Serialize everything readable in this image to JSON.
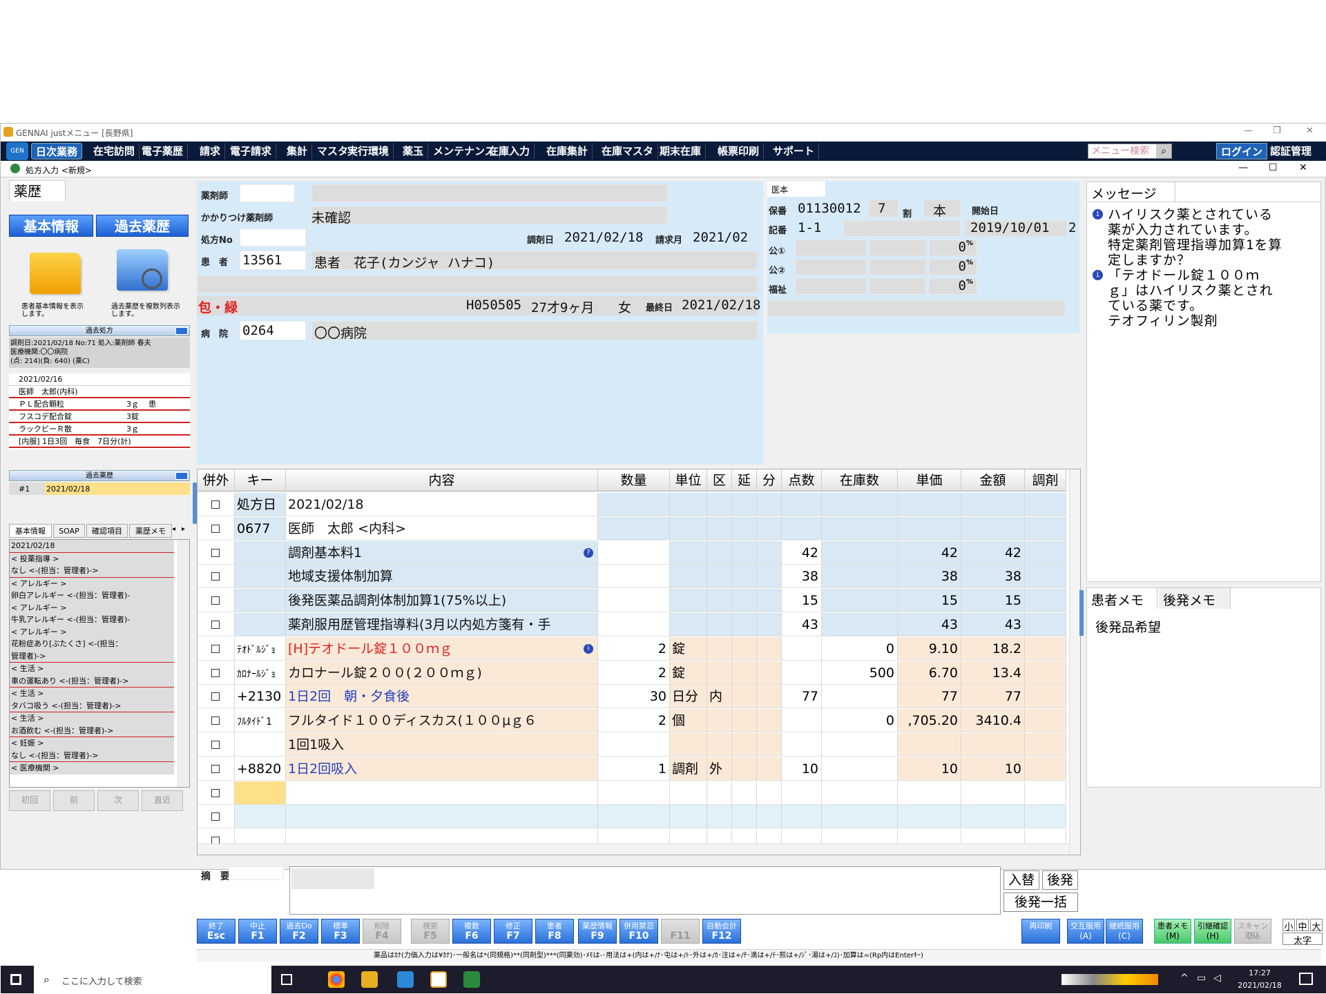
{
  "window": {
    "title": "GENNAI justメニュー [長野県]",
    "sub_title": "処方入力 <新規>"
  },
  "menu": {
    "logo": "GEN",
    "items": [
      "日次業務",
      "在宅訪問",
      "電子薬歴",
      "請求",
      "電子請求",
      "集計",
      "マスタ",
      "実行環境",
      "薬玉",
      "メンテナンス",
      "在庫入力",
      "在庫集計",
      "在庫マスタ",
      "期末在庫",
      "帳票印刷",
      "サポート"
    ],
    "search_placeholder": "メニュー検索",
    "login": "ログイン",
    "auth": "認証管理"
  },
  "left": {
    "tab": "薬歴",
    "btn_basic": "基本情報",
    "btn_past": "過去薬歴",
    "basic_caption": "患者基本情報を表示します。",
    "past_caption": "過去薬歴を複数列表示します。",
    "past_rx_header": "過去処方",
    "past_rx_info": [
      "調剤日:2021/02/18 No:71 処入:薬剤師 春夫",
      "医療機関:〇〇病院",
      "(点: 214)(負: 640) (薬C)"
    ],
    "rx_rows": [
      [
        "2021/02/16",
        "",
        ""
      ],
      [
        "医師　太郎(内科)",
        "",
        ""
      ],
      [
        "ＰＬ配合顆粒",
        "3ｇ",
        "患"
      ],
      [
        "フスコデ配合錠",
        "3錠",
        ""
      ],
      [
        "ラックビーＲ散",
        "3ｇ",
        ""
      ],
      [
        "[内服] 1日3回　毎食　7日分(計)",
        "",
        ""
      ]
    ],
    "past_history_header": "過去薬歴",
    "past_history_row": [
      "#1",
      "2021/02/18"
    ],
    "tabs": [
      "基本情報",
      "SOAP",
      "確認項目",
      "薬歴メモ"
    ],
    "memo_lines": [
      "2021/02/18",
      "< 投薬指導 >",
      "なし <-(担当：管理者)->",
      "< アレルギー >",
      "卵白アレルギー <-(担当：管理者)-",
      "< アレルギー >",
      "牛乳アレルギー <-(担当：管理者)-",
      "< アレルギー >",
      "花粉症あり[ぶたくさ] <-(担当：",
      "管理者)->",
      "< 生活 >",
      "車の運転あり <-(担当：管理者)->",
      "< 生活 >",
      "タバコ吸う <-(担当：管理者)->",
      "< 生活 >",
      "お酒飲む <-(担当：管理者)->",
      "< 妊娠 >",
      "なし <-(担当：管理者)->",
      "< 医療機関 >"
    ],
    "nav": [
      "初回",
      "前",
      "次",
      "直近"
    ]
  },
  "header": {
    "pharmacist_label": "薬剤師",
    "kakaritsuke_label": "かかりつけ薬剤師",
    "kakaritsuke_value": "未確認",
    "rxno_label": "処方No",
    "dispense_date_label": "調剤日",
    "dispense_date": "2021/02/18",
    "claim_month_label": "請求月",
    "claim_month": "2021/02",
    "patient_label": "患　者",
    "patient_id": "13561",
    "patient_name": "患者　花子(カンジャ ハナコ)",
    "insurance_tag": "包・緑",
    "patient_code": "H050505",
    "age": "27才9ヶ月",
    "sex": "女",
    "last_date_label": "最終日",
    "last_date": "2021/02/18",
    "hospital_label": "病　院",
    "hospital_id": "0264",
    "hospital_name": "〇〇病院",
    "ins_tab": "医本",
    "hoban_label": "保番",
    "hoban": "01130012",
    "hoban_7": "7",
    "wari_label": "割",
    "hon": "本",
    "start_label": "開始日",
    "kiban_label": "記番",
    "kiban": "1-1",
    "start_date": "2019/10/01",
    "start_num": "2",
    "kou1_label": "公①",
    "kou2_label": "公②",
    "fuku_label": "福祉",
    "zero": "0"
  },
  "grid": {
    "headers": [
      "併外",
      "キー",
      "内容",
      "数量",
      "単位",
      "区",
      "延",
      "分",
      "点数",
      "在庫数",
      "単価",
      "金額",
      "調剤"
    ],
    "rows": [
      {
        "key": "処方日",
        "content": "2021/02/18",
        "qty": "",
        "unit": "",
        "ku": "",
        "pts": "",
        "stock": "",
        "price": "",
        "amount": "",
        "type": "rx",
        "c": "black"
      },
      {
        "key": "0677",
        "content": "医師　太郎 <内科>",
        "qty": "",
        "unit": "",
        "ku": "",
        "pts": "",
        "stock": "",
        "price": "",
        "amount": "",
        "type": "rx",
        "c": "black"
      },
      {
        "key": "",
        "content": "調剤基本料1",
        "qty": "",
        "unit": "",
        "ku": "",
        "pts": "42",
        "stock": "",
        "price": "42",
        "amount": "42",
        "type": "fee",
        "c": "black",
        "info": true
      },
      {
        "key": "",
        "content": "地域支援体制加算",
        "qty": "",
        "unit": "",
        "ku": "",
        "pts": "38",
        "stock": "",
        "price": "38",
        "amount": "38",
        "type": "fee",
        "c": "black"
      },
      {
        "key": "",
        "content": "後発医薬品調剤体制加算1(75%以上)",
        "qty": "",
        "unit": "",
        "ku": "",
        "pts": "15",
        "stock": "",
        "price": "15",
        "amount": "15",
        "type": "fee",
        "c": "black"
      },
      {
        "key": "",
        "content": "薬剤服用歴管理指導料(3月以内処方箋有・手",
        "qty": "",
        "unit": "",
        "ku": "",
        "pts": "43",
        "stock": "",
        "price": "43",
        "amount": "43",
        "type": "fee",
        "c": "black"
      },
      {
        "key": "ﾃｵﾄﾞﾙｼﾞｮ",
        "content": "[H]テオドール錠１００ｍｇ",
        "qty": "2",
        "unit": "錠",
        "ku": "",
        "pts": "",
        "stock": "0",
        "price": "9.10",
        "amount": "18.2",
        "type": "drug",
        "c": "red",
        "info": true
      },
      {
        "key": "ｶﾛﾅｰﾙｼﾞｮ",
        "content": "カロナール錠２００(２００ｍｇ)",
        "qty": "2",
        "unit": "錠",
        "ku": "",
        "pts": "",
        "stock": "500",
        "price": "6.70",
        "amount": "13.4",
        "type": "drug",
        "c": "black"
      },
      {
        "key": "+2130",
        "content": "1日2回　朝・夕食後",
        "qty": "30",
        "unit": "日分",
        "ku": "内",
        "pts": "77",
        "stock": "",
        "price": "77",
        "amount": "77",
        "type": "usage",
        "c": "blue"
      },
      {
        "key": "ﾌﾙﾀｲﾄﾞ1",
        "content": "フルタイド１００ディスカス(１００μｇ６",
        "qty": "2",
        "unit": "個",
        "ku": "",
        "pts": "",
        "stock": "0",
        "price": ",705.20",
        "amount": "3410.4",
        "type": "drug",
        "c": "black"
      },
      {
        "key": "",
        "content": "1回1吸入",
        "qty": "",
        "unit": "",
        "ku": "",
        "pts": "",
        "stock": "",
        "price": "",
        "amount": "",
        "type": "drug",
        "c": "black"
      },
      {
        "key": "+8820",
        "content": "1日2回吸入",
        "qty": "1",
        "unit": "調剤",
        "ku": "外",
        "pts": "10",
        "stock": "",
        "price": "10",
        "amount": "10",
        "type": "usage",
        "c": "blue"
      },
      {
        "key": "",
        "content": "",
        "qty": "",
        "unit": "",
        "ku": "",
        "pts": "",
        "stock": "",
        "price": "",
        "amount": "",
        "type": "empty",
        "c": "black"
      },
      {
        "key": "",
        "content": "",
        "qty": "",
        "unit": "",
        "ku": "",
        "pts": "",
        "stock": "",
        "price": "",
        "amount": "",
        "type": "empty2",
        "c": "black"
      },
      {
        "key": "",
        "content": "",
        "qty": "",
        "unit": "",
        "ku": "",
        "pts": "",
        "stock": "",
        "price": "",
        "amount": "",
        "type": "empty",
        "c": "black"
      }
    ]
  },
  "summary": {
    "label": "摘　要"
  },
  "side_buttons": {
    "swap": "入替",
    "generic": "後発",
    "generic_all": "後発一括"
  },
  "message": {
    "tab": "メッセージ",
    "lines": [
      {
        "icon": true,
        "text": "ハイリスク薬とされている"
      },
      {
        "icon": false,
        "text": "薬が入力されています。"
      },
      {
        "icon": false,
        "text": "特定薬剤管理指導加算1を算"
      },
      {
        "icon": false,
        "text": "定しますか？"
      },
      {
        "icon": true,
        "text": "「テオドール錠１００ｍ"
      },
      {
        "icon": false,
        "text": "ｇ」はハイリスク薬とされ"
      },
      {
        "icon": false,
        "text": "ている薬です。"
      },
      {
        "icon": false,
        "text": "テオフィリン製剤"
      }
    ]
  },
  "memo": {
    "tab1": "患者メモ",
    "tab2": "後発メモ",
    "text": "後発品希望"
  },
  "fkeys": [
    {
      "t": "終了",
      "k": "Esc",
      "s": ""
    },
    {
      "t": "中止",
      "k": "F1",
      "s": ""
    },
    {
      "t": "過去Do",
      "k": "F2",
      "s": ""
    },
    {
      "t": "標準",
      "k": "F3",
      "s": ""
    },
    {
      "t": "削除",
      "k": "F4",
      "s": "dis"
    },
    {
      "t": "検索",
      "k": "F5",
      "s": "dis"
    },
    {
      "t": "複数",
      "k": "F6",
      "s": ""
    },
    {
      "t": "修正",
      "k": "F7",
      "s": ""
    },
    {
      "t": "患者",
      "k": "F8",
      "s": ""
    },
    {
      "t": "薬歴情報",
      "k": "F9",
      "s": ""
    },
    {
      "t": "併用禁忌",
      "k": "F10",
      "s": ""
    },
    {
      "t": "",
      "k": "F11",
      "s": "dis"
    },
    {
      "t": "自動会計",
      "k": "F12",
      "s": ""
    }
  ],
  "rbtns": [
    {
      "t": "再印刷",
      "k": "",
      "s": ""
    },
    {
      "t": "交互服用",
      "k": "(A)",
      "s": ""
    },
    {
      "t": "継続服用",
      "k": "(C)",
      "s": ""
    },
    {
      "t": "患者メモ",
      "k": "(M)",
      "s": "grn"
    },
    {
      "t": "引継確認",
      "k": "(H)",
      "s": "grn"
    },
    {
      "t": "スキャン取込",
      "k": "(S)",
      "s": "dis"
    }
  ],
  "fontsize": {
    "small": "小",
    "mid": "中",
    "large": "大",
    "bold": "太字"
  },
  "statusbar": "薬品はｶﾅ(力価入力は¥ｶﾅ)･一般名は*(同規格)**(同剤型)***(同薬効)･ﾒﾓは-･用法は+(内は+/ﾅ･屯は+/ﾄ･外は+/ｶ･注は+/ﾁ･滴は+/ﾃ･煎は+/ｼﾞ･湯は+/ﾕ)･加算は=(Rp内はEnterｷｰ)",
  "taskbar": {
    "search": "ここに入力して検索",
    "time": "17:27",
    "date": "2021/02/18"
  }
}
